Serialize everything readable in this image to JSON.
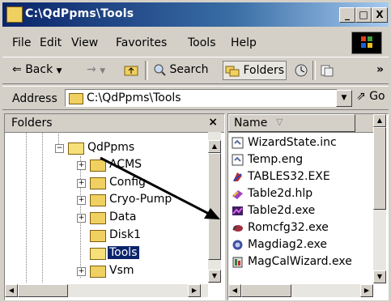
{
  "window": {
    "title": "C:\\QdPpms\\Tools"
  },
  "titlebar_buttons": {
    "minimize": "_",
    "maximize": "□",
    "close": "X"
  },
  "menu": [
    "File",
    "Edit",
    "View",
    "Favorites",
    "Tools",
    "Help"
  ],
  "toolbar": {
    "back": "Back",
    "forward": "→",
    "search": "Search",
    "folders": "Folders",
    "more": "»"
  },
  "address": {
    "label": "Address",
    "path": "C:\\QdPpms\\Tools",
    "go": "Go"
  },
  "folders_panel": {
    "title": "Folders",
    "close": "×",
    "items": [
      {
        "label": "QdPpms",
        "expander": "−"
      },
      {
        "label": "ACMS",
        "expander": "+"
      },
      {
        "label": "Config",
        "expander": "+"
      },
      {
        "label": "Cryo-Pump",
        "expander": "+"
      },
      {
        "label": "Data",
        "expander": "+"
      },
      {
        "label": "Disk1",
        "expander": ""
      },
      {
        "label": "Tools",
        "expander": ""
      },
      {
        "label": "Vsm",
        "expander": "+"
      }
    ],
    "selected": "Tools"
  },
  "files_panel": {
    "column_name": "Name",
    "sort_indicator": "▽",
    "files": [
      {
        "name": "WizardState.inc",
        "icon": "text-file-icon",
        "color": "#5a6ea0"
      },
      {
        "name": "Temp.eng",
        "icon": "text-file-icon",
        "color": "#5a6ea0"
      },
      {
        "name": "TABLES32.EXE",
        "icon": "exe-app-icon",
        "color": "#c03030"
      },
      {
        "name": "Table2d.hlp",
        "icon": "help-file-icon",
        "color": "#a040c0"
      },
      {
        "name": "Table2d.exe",
        "icon": "exe-graph-icon",
        "color": "#8020a0"
      },
      {
        "name": "Romcfg32.exe",
        "icon": "exe-tool-icon",
        "color": "#a03040"
      },
      {
        "name": "Magdiag2.exe",
        "icon": "exe-gear-icon",
        "color": "#4050a0"
      },
      {
        "name": "MagCalWizard.exe",
        "icon": "exe-wizard-icon",
        "color": "#308040"
      }
    ]
  },
  "colors": {
    "titlebar_start": "#0a246a",
    "titlebar_end": "#a6caf0",
    "selection": "#0a246a",
    "chrome": "#d4d0c8"
  }
}
